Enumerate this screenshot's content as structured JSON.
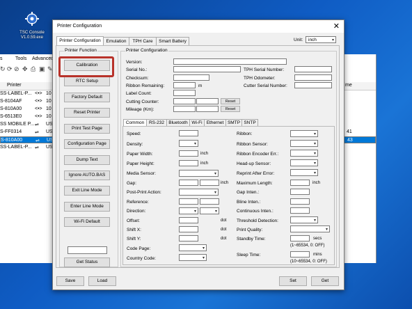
{
  "desktop": {
    "icon_label_1": "TSC Console",
    "icon_label_2": "V1.0.59.exe"
  },
  "bgapp": {
    "menu": [
      "Tools",
      "Advanced"
    ],
    "columns": [
      "Printer",
      "me"
    ],
    "rows": [
      {
        "name": "SS-LABEL-P...",
        "io": "10",
        "last": ""
      },
      {
        "name": "S-8104AF",
        "io": "10",
        "last": ""
      },
      {
        "name": "S-810A00",
        "io": "10",
        "last": ""
      },
      {
        "name": "S-6513E0",
        "io": "10",
        "last": ""
      },
      {
        "name": "SS MOBILE P...",
        "io": "US",
        "last": ""
      },
      {
        "name": "S-FF0314",
        "io": "US",
        "last": "41"
      },
      {
        "name": "S-810A00",
        "io": "US",
        "last": "43"
      },
      {
        "name": "SS-LABEL-P...",
        "io": "US",
        "last": ""
      }
    ]
  },
  "dialog": {
    "title": "Printer Configuration",
    "tabs": [
      "Printer Configuration",
      "Emulation",
      "TPH Care",
      "Smart Battery"
    ],
    "unit_label": "Unit:",
    "unit_value": "inch",
    "printer_function_title": "Printer Function",
    "function_buttons": [
      "Calibration",
      "RTC Setup",
      "Factory Default",
      "Reset Printer",
      "Print Test Page",
      "Configuration Page",
      "Dump Text",
      "Ignore AUTO.BAS",
      "Exit Line Mode",
      "Enter Line Mode",
      "Wi-Fi Default"
    ],
    "get_status": "Get Status",
    "printer_config_title": "Printer Configuration",
    "info": {
      "version": "Version:",
      "serial": "Serial No.:",
      "checksum": "Checksum:",
      "ribbon": "Ribbon Remaining:",
      "ribbon_unit": "m",
      "label_count": "Label Count:",
      "cutting": "Cutting Counter:",
      "mileage": "Mileage (Km):",
      "tph_serial": "TPH Serial Number:",
      "tph_odo": "TPH Odometer:",
      "cutter_serial": "Cutter Serial Number:",
      "reset": "Reset"
    },
    "subtabs": [
      "Common",
      "RS-232",
      "Bluetooth",
      "Wi-Fi",
      "Ethernet",
      "SMTP",
      "SNTP"
    ],
    "left_fields": {
      "speed": "Speed:",
      "density": "Density:",
      "paper_width": "Paper Width:",
      "paper_height": "Paper Height:",
      "media_sensor": "Media Sensor:",
      "gap": "Gap:",
      "post_print": "Post-Print Action:",
      "reference": "Reference:",
      "direction": "Direction:",
      "offset": "Offset:",
      "shift_x": "Shift X:",
      "shift_y": "Shift Y:",
      "code_page": "Code Page:",
      "country_code": "Country Code:",
      "inch": "inch",
      "dot": "dot"
    },
    "right_fields": {
      "ribbon": "Ribbon:",
      "ribbon_sensor": "Ribbon Sensor:",
      "ribbon_encoder": "Ribbon Encoder Err.:",
      "headup": "Head-up Sensor:",
      "reprint": "Reprint After Error:",
      "max_length": "Maximum Length:",
      "gap_inten": "Gap Inten.:",
      "bline_inten": "Bline Inten.:",
      "cont_inten": "Continuous Inten.:",
      "threshold": "Threshold Detection:",
      "print_quality": "Print Quality:",
      "standby": "Standby Time:",
      "secs": "secs",
      "standby_range": "(1~65534, 0: OFF)",
      "sleep": "Sleep Time:",
      "mins": "mins",
      "sleep_range": "(10~65534, 0: OFF)",
      "inch": "inch"
    },
    "bottom": {
      "save": "Save",
      "load": "Load",
      "set": "Set",
      "get": "Get"
    }
  }
}
